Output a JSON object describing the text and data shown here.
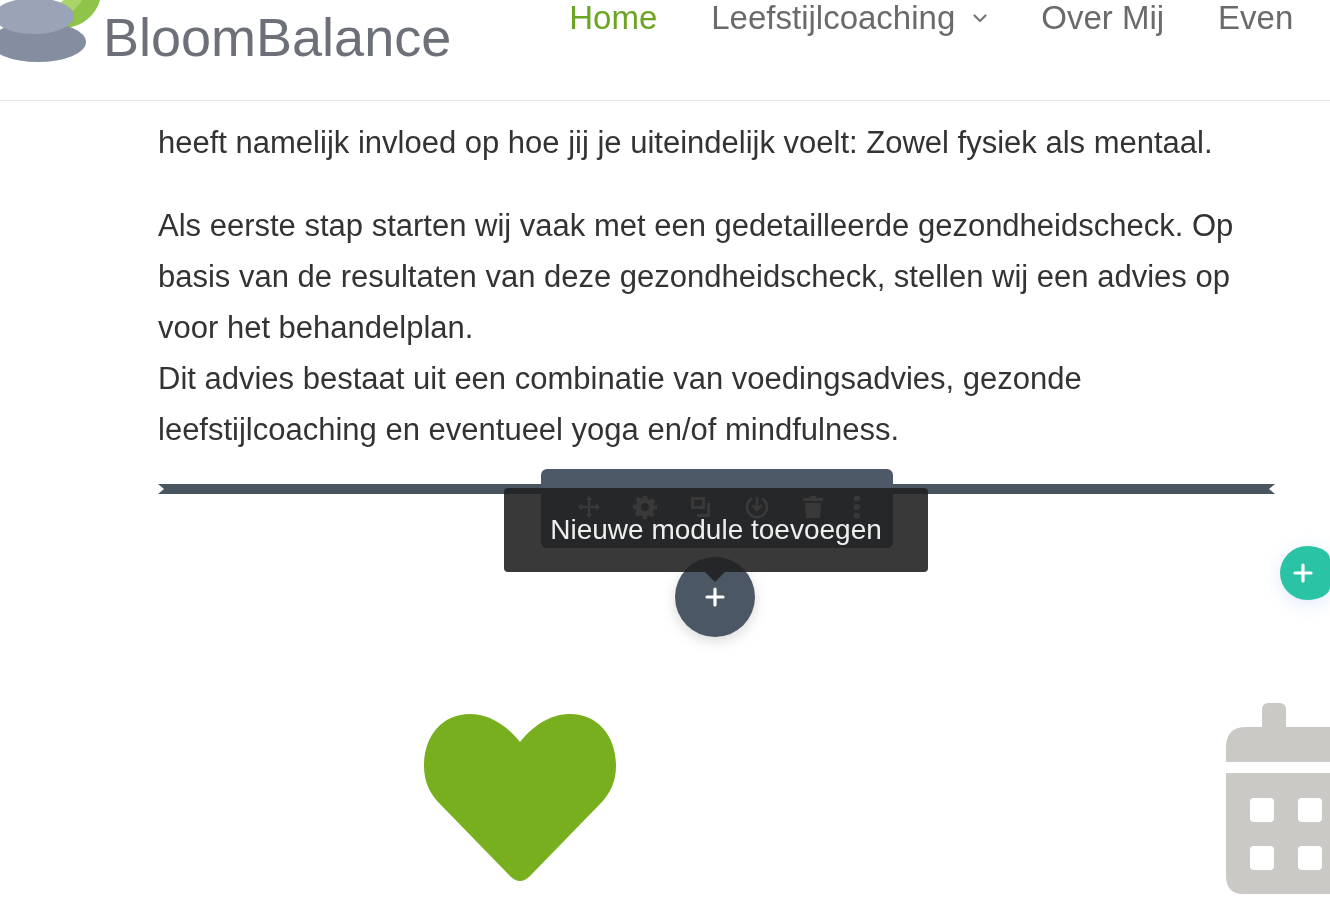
{
  "header": {
    "logo": {
      "text": "BloomBalance"
    },
    "nav": [
      {
        "label": "Home",
        "selected": true,
        "dropdown": false
      },
      {
        "label": "Leefstijlcoaching",
        "selected": false,
        "dropdown": true
      },
      {
        "label": "Over Mij",
        "selected": false,
        "dropdown": false
      },
      {
        "label": "Even",
        "selected": false,
        "dropdown": false
      }
    ]
  },
  "content": {
    "paragraphs": [
      {
        "lines": [
          "heeft namelijk invloed op hoe jij je uiteindelijk voelt: Zowel fysiek als mentaal."
        ]
      },
      {
        "lines": [
          "Als eerste stap starten wij vaak met een gedetailleerde gezondheidscheck. Op",
          "basis van de resultaten van deze gezondheidscheck, stellen wij een advies op",
          "voor het behandelplan.",
          "Dit advies bestaat uit een combinatie van voedingsadvies, gezonde",
          "leefstijlcoaching en eventueel yoga en/of mindfulness."
        ]
      }
    ]
  },
  "builder": {
    "tooltip": "Nieuwe module toevoegen"
  }
}
